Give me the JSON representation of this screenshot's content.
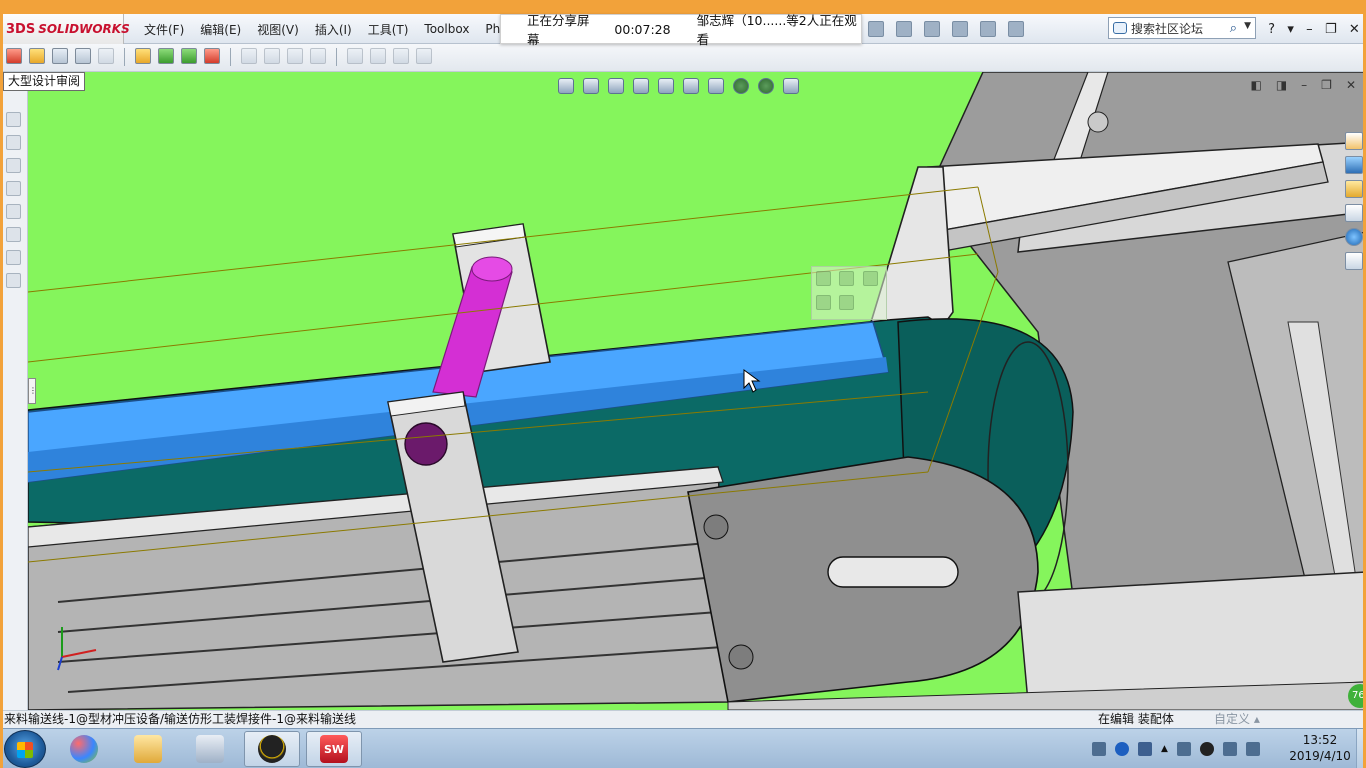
{
  "app": {
    "brand_mark": "3DS",
    "brand": "SOLIDWORKS"
  },
  "menu": [
    "文件(F)",
    "编辑(E)",
    "视图(V)",
    "插入(I)",
    "工具(T)",
    "Toolbox",
    "PhotoVi"
  ],
  "share_overlay": {
    "status": "正在分享屏幕",
    "elapsed": "00:07:28",
    "viewers": "邹志辉（10......等2人正在观看"
  },
  "search": {
    "placeholder": "搜索社区论坛"
  },
  "window_buttons": [
    "?",
    "▾",
    "–",
    "❐",
    "✕"
  ],
  "tooltip": "大型设计审阅",
  "statusbar": {
    "path": "来料输送线-1@型材冲压设备/输送仿形工装焊接件-1@来料输送线",
    "mode": "在编辑 装配体",
    "custom": "自定义 ▴"
  },
  "clock": {
    "time": "13:52",
    "date": "2019/4/10"
  },
  "badge": "76",
  "colors": {
    "viewport_bg": "#85f55c",
    "belt": "#006060",
    "rail_blue": "#4aa6ff",
    "pin": "#d42fd4",
    "accent": "#c8102e"
  },
  "icons": {
    "headsup": [
      "zoom-to-fit-icon",
      "zoom-area-icon",
      "previous-view-icon",
      "section-view-icon",
      "view-orientation-icon",
      "display-style-icon",
      "hide-show-icon",
      "edit-appearance-icon",
      "apply-scene-icon",
      "view-settings-icon"
    ],
    "taskpane": [
      "home-icon",
      "resources-icon",
      "design-library-icon",
      "file-explorer-icon",
      "appearances-icon",
      "custom-properties-icon"
    ]
  }
}
